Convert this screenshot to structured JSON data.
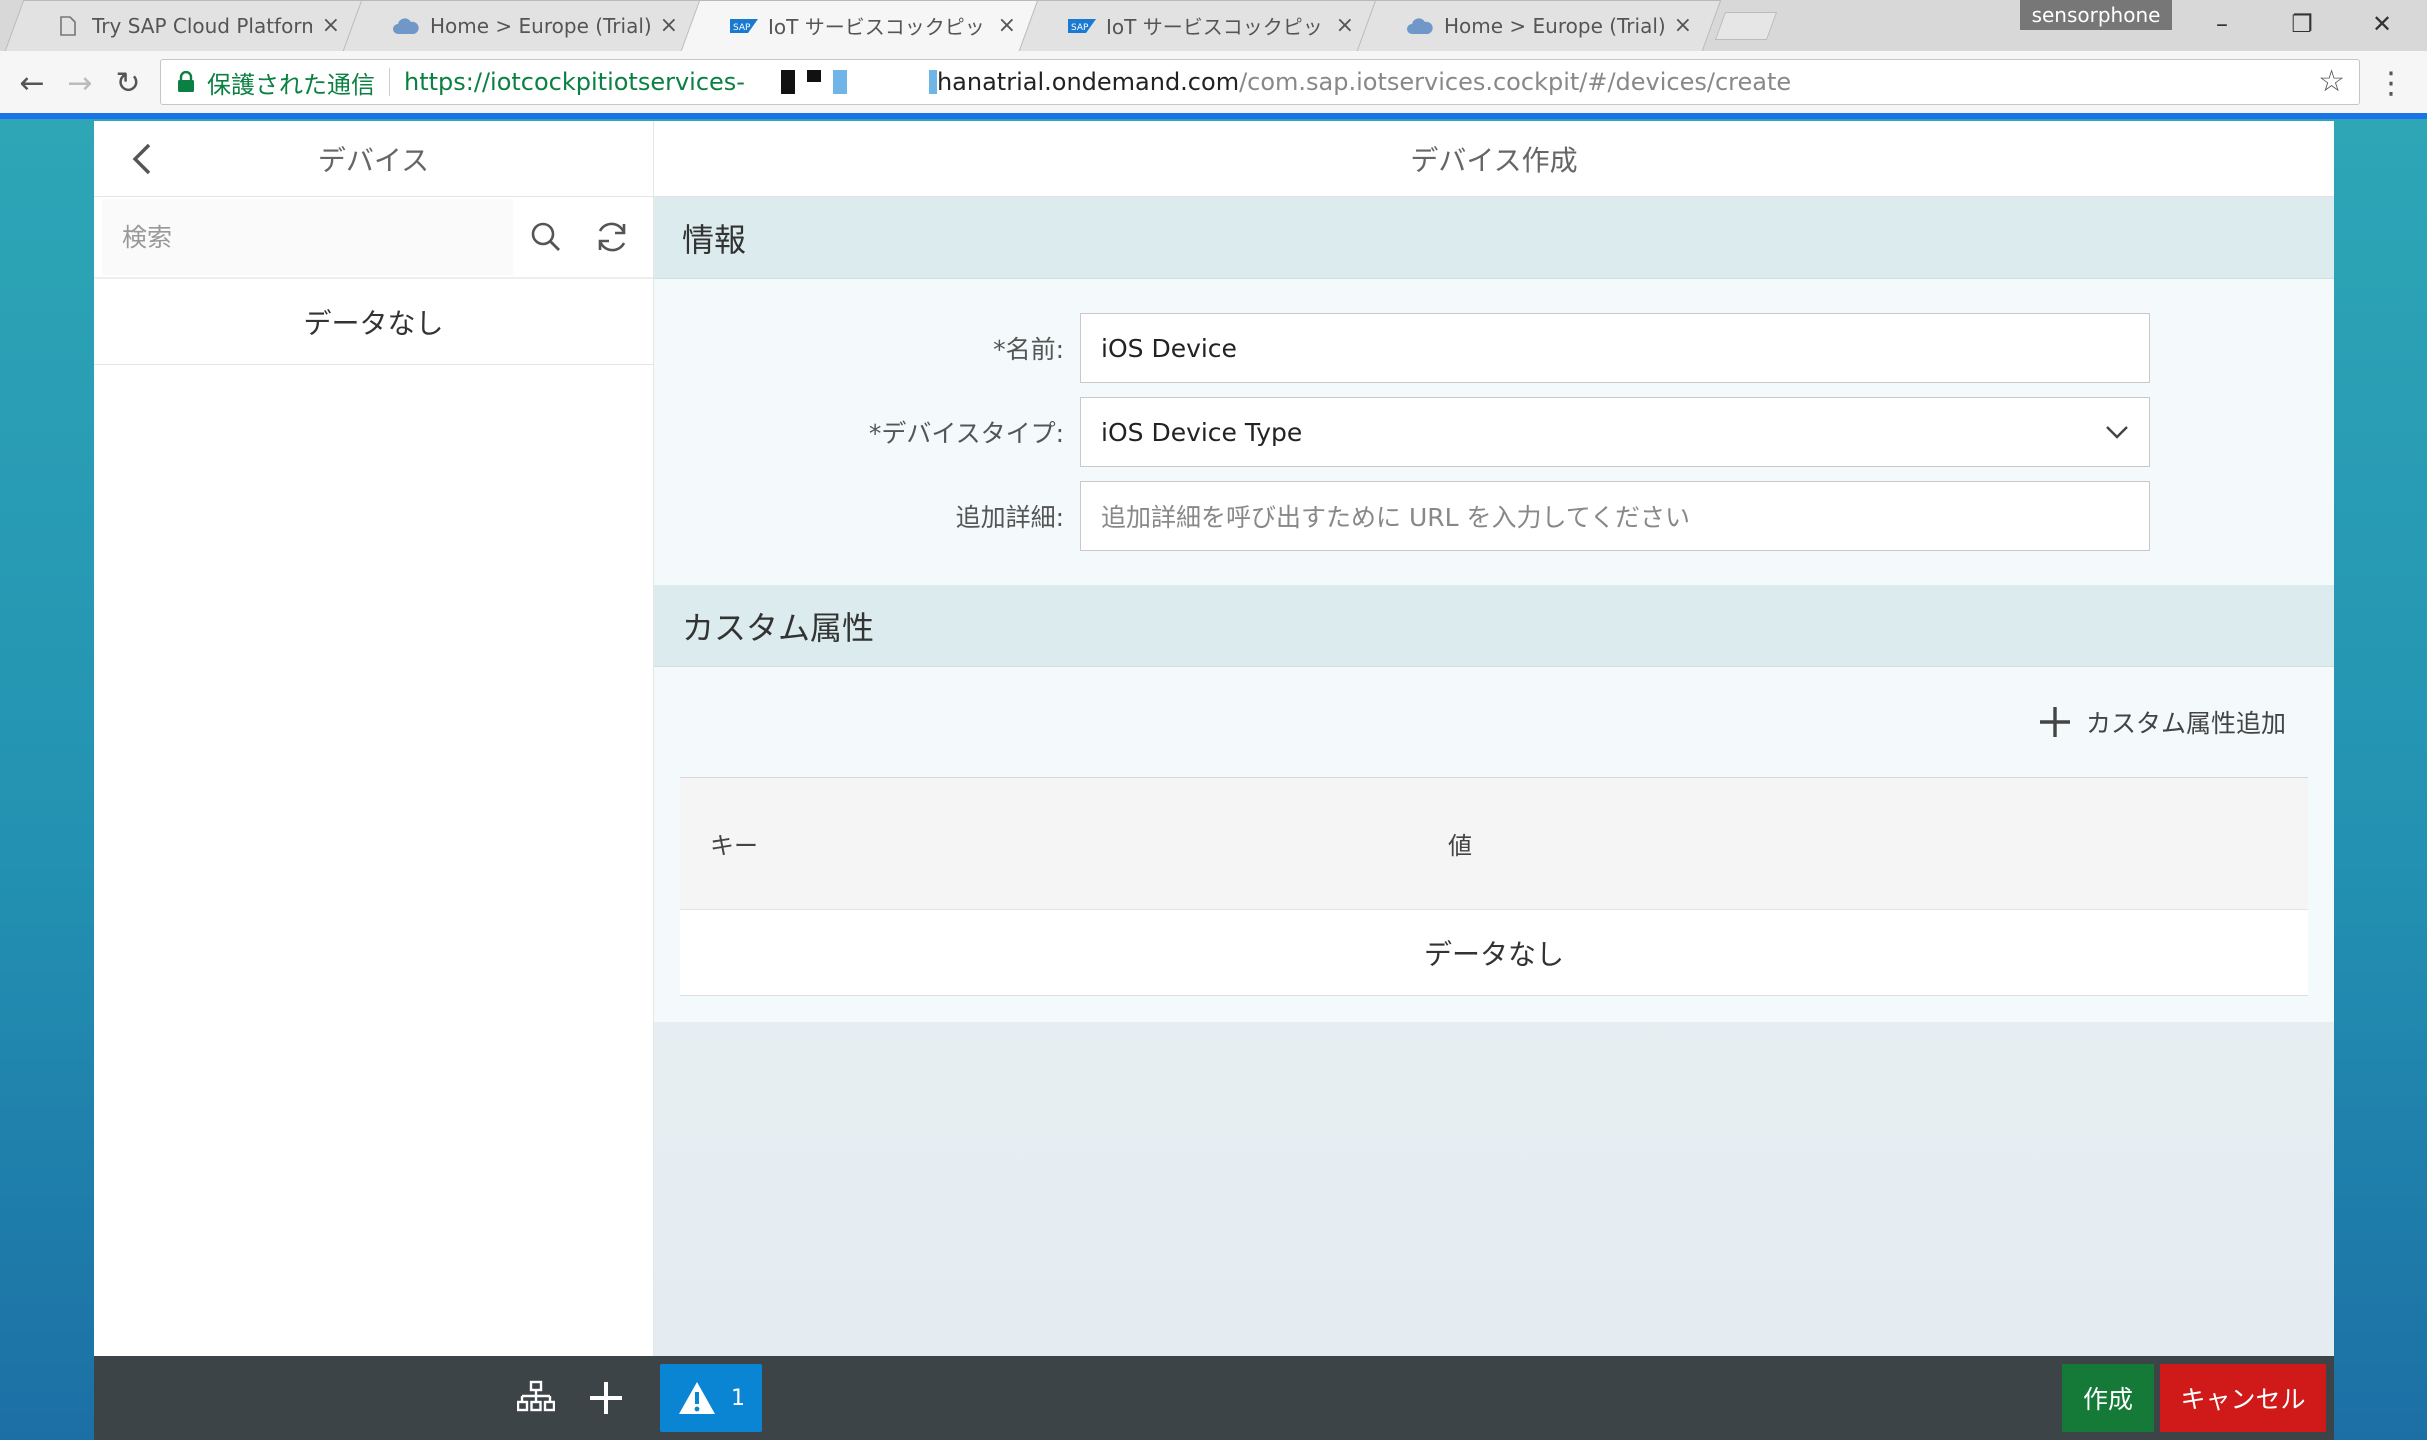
{
  "browser": {
    "tabs": [
      {
        "title": "Try SAP Cloud Platform",
        "icon": "doc-icon"
      },
      {
        "title": "Home > Europe (Trial) >",
        "icon": "cloud-icon"
      },
      {
        "title": "IoT サービスコックピット",
        "icon": "sap-icon"
      },
      {
        "title": "IoT サービスコックピット",
        "icon": "sap-icon"
      },
      {
        "title": "Home > Europe (Trial) >",
        "icon": "cloud-icon"
      }
    ],
    "profile": "sensorphone",
    "secure_label": "保護された通信",
    "url_scheme": "https://iotcockpitiotservices-",
    "url_host": "hanatrial.ondemand.com",
    "url_path": "/com.sap.iotservices.cockpit/#/devices/create"
  },
  "master": {
    "title": "デバイス",
    "search_placeholder": "検索",
    "no_data": "データなし"
  },
  "detail": {
    "title": "デバイス作成",
    "info_section": "情報",
    "fields": {
      "name_label": "*名前:",
      "name_value": "iOS Device",
      "type_label": "*デバイスタイプ:",
      "type_value": "iOS Device Type",
      "extra_label": "追加詳細:",
      "extra_placeholder": "追加詳細を呼び出すために URL を入力してください"
    },
    "custom_section": "カスタム属性",
    "add_custom": "カスタム属性追加",
    "table": {
      "col_key": "キー",
      "col_value": "値",
      "no_data": "データなし"
    }
  },
  "footer": {
    "warning_count": "1",
    "create": "作成",
    "cancel": "キャンセル"
  },
  "colors": {
    "accent": "#0a85d4",
    "create": "#157a38",
    "cancel": "#d01a1a"
  }
}
